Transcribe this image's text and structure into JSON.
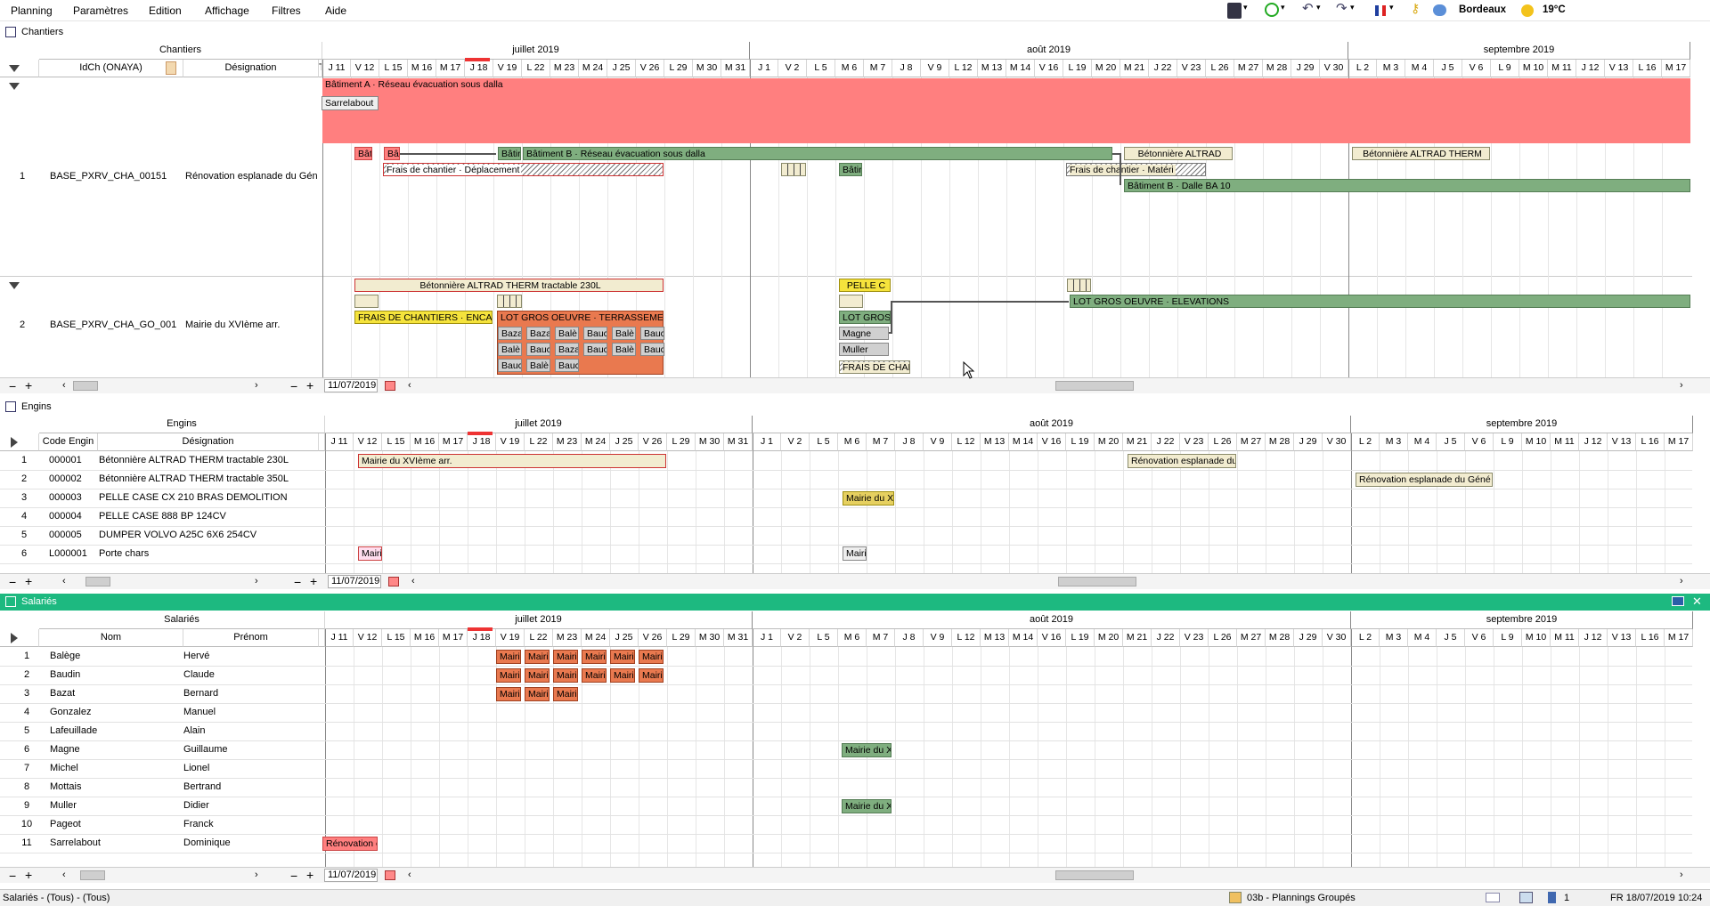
{
  "menu": [
    "Planning",
    "Paramètres",
    "Edition",
    "Affichage",
    "Filtres",
    "Aide"
  ],
  "toolbar": {
    "city": "Bordeaux",
    "temperature": "19°C"
  },
  "accent_colors": {
    "salaries_header": "#1db980",
    "red": "#ff7f7f",
    "green": "#7fae7f"
  },
  "months": [
    "juillet 2019",
    "août 2019",
    "septembre 2019"
  ],
  "days": [
    "J 11",
    "V 12",
    "L 15",
    "M 16",
    "M 17",
    "J 18",
    "V 19",
    "L 22",
    "M 23",
    "M 24",
    "J 25",
    "V 26",
    "L 29",
    "M 30",
    "M 31",
    "J 1",
    "V 2",
    "L 5",
    "M 6",
    "M 7",
    "J 8",
    "V 9",
    "L 12",
    "M 13",
    "M 14",
    "V 16",
    "L 19",
    "M 20",
    "M 21",
    "J 22",
    "V 23",
    "L 26",
    "M 27",
    "M 28",
    "J 29",
    "V 30",
    "L 2",
    "M 3",
    "M 4",
    "J 5",
    "V 6",
    "L 9",
    "M 10",
    "M 11",
    "J 12",
    "V 13",
    "L 16",
    "M 17"
  ],
  "chantiers": {
    "title": "Chantiers",
    "group_header": "Chantiers",
    "col_id": "IdCh (ONAYA)",
    "col_designation": "Désignation",
    "col_t": "T",
    "rows": [
      {
        "n": "1",
        "id": "BASE_PXRV_CHA_00151",
        "designation": "Rénovation esplanade du Géné"
      },
      {
        "n": "2",
        "id": "BASE_PXRV_CHA_GO_001",
        "designation": "Mairie du XVIème arr."
      }
    ],
    "bars": {
      "b1": "Bâtiment A · Réseau évacuation sous dalla",
      "b2": "Sarrelabout",
      "b3": "Bât",
      "b4": "Bât",
      "b5": "Bâtir",
      "b6": "Bâtiment B · Réseau évacuation sous dalla",
      "b7": "Bétonnière ALTRAD",
      "b8": "Bétonnière ALTRAD THERM",
      "b9": "Frais de chantier · Déplacement",
      "b10": "Bâtir",
      "b11": "Frais de chantier · Matéri",
      "b12": "Bâtiment B · Dalle BA 10",
      "c1": "Bétonnière ALTRAD THERM tractable 230L",
      "c2": "PELLE C",
      "c3": "LOT GROS OEUVRE · ELEVATIONS",
      "c4": "FRAIS DE CHANTIERS · ENCAD",
      "c5": "LOT GROS OEUVRE · TERRASSEMENT",
      "c6": "LOT GROS",
      "c7": "Magne",
      "c8": "Muller",
      "c9": "FRAIS DE CHAN",
      "w1": "Baza",
      "w2": "Baza",
      "w3": "Balè",
      "w4": "Bauc",
      "w5": "Balè",
      "w6": "Bauc",
      "w7": "Balè",
      "w8": "Bauc",
      "w9": "Baza",
      "w10": "Bauc",
      "w11": "Balè",
      "w12": "Bauc",
      "w13": "Bauc",
      "w14": "Balè",
      "w15": "Bauc"
    },
    "date": "11/07/2019"
  },
  "engins": {
    "title": "Engins",
    "group_header": "Engins",
    "col_code": "Code Engin",
    "col_designation": "Désignation",
    "rows": [
      {
        "n": "1",
        "code": "000001",
        "designation": "Bétonnière ALTRAD THERM tractable 230L"
      },
      {
        "n": "2",
        "code": "000002",
        "designation": "Bétonnière ALTRAD THERM tractable 350L"
      },
      {
        "n": "3",
        "code": "000003",
        "designation": "PELLE CASE CX 210 BRAS DEMOLITION"
      },
      {
        "n": "4",
        "code": "000004",
        "designation": "PELLE CASE 888 BP 124CV"
      },
      {
        "n": "5",
        "code": "000005",
        "designation": "DUMPER VOLVO A25C 6X6 254CV"
      },
      {
        "n": "6",
        "code": "L000001",
        "designation": "Porte chars"
      }
    ],
    "bars": {
      "e1": "Mairie du XVIème arr.",
      "e2": "Rénovation esplanade du",
      "e3": "Rénovation esplanade du Géné",
      "e4": "Mairie du X",
      "e5": "Mairi",
      "e6": "Mairi"
    },
    "date": "11/07/2019"
  },
  "salaries": {
    "title": "Salariés",
    "group_header": "Salariés",
    "col_nom": "Nom",
    "col_prenom": "Prénom",
    "rows": [
      {
        "n": "1",
        "nom": "Balège",
        "prenom": "Hervé"
      },
      {
        "n": "2",
        "nom": "Baudin",
        "prenom": "Claude"
      },
      {
        "n": "3",
        "nom": "Bazat",
        "prenom": "Bernard"
      },
      {
        "n": "4",
        "nom": "Gonzalez",
        "prenom": "Manuel"
      },
      {
        "n": "5",
        "nom": "Lafeuillade",
        "prenom": "Alain"
      },
      {
        "n": "6",
        "nom": "Magne",
        "prenom": "Guillaume"
      },
      {
        "n": "7",
        "nom": "Michel",
        "prenom": "Lionel"
      },
      {
        "n": "8",
        "nom": "Mottais",
        "prenom": "Bertrand"
      },
      {
        "n": "9",
        "nom": "Muller",
        "prenom": "Didier"
      },
      {
        "n": "10",
        "nom": "Pageot",
        "prenom": "Franck"
      },
      {
        "n": "11",
        "nom": "Sarrelabout",
        "prenom": "Dominique"
      }
    ],
    "bars": {
      "s_mairi": "Mairi",
      "s6": "Mairie du X",
      "s9": "Mairie du X",
      "s11": "Rénovation e"
    },
    "date": "11/07/2019"
  },
  "status": {
    "left": "Salariés - (Tous) - (Tous)",
    "planning": "03b - Plannings Groupés",
    "users": "1",
    "datetime": "FR 18/07/2019 10:24"
  }
}
